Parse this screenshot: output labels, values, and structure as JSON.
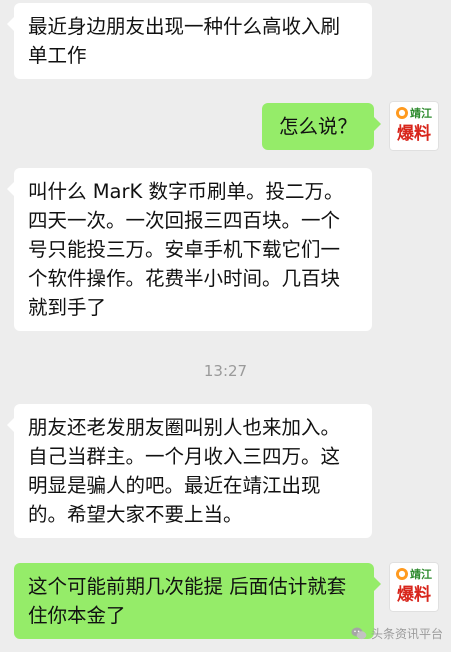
{
  "messages": [
    {
      "side": "left",
      "text": "最近身边朋友出现一种什么高收入刷单工作"
    },
    {
      "side": "right",
      "text": "怎么说？"
    },
    {
      "side": "left",
      "text": "叫什么 MarK 数字币刷单。投二万。四天一次。一次回报三四百块。一个号只能投三万。安卓手机下载它们一个软件操作。花费半小时间。几百块就到手了"
    },
    {
      "side": "left",
      "text": "朋友还老发朋友圈叫别人也来加入。自己当群主。一个月收入三四万。这明显是骗人的吧。最近在靖江出现的。希望大家不要上当。"
    },
    {
      "side": "right",
      "text": "这个可能前期几次能提 后面估计就套住你本金了"
    }
  ],
  "timestamp": "13:27",
  "avatar": {
    "top_text": "靖江",
    "bottom_text": "爆料"
  },
  "watermark": "头条资讯平台",
  "colors": {
    "background": "#ededed",
    "left_bubble": "#ffffff",
    "right_bubble": "#95ec69"
  }
}
